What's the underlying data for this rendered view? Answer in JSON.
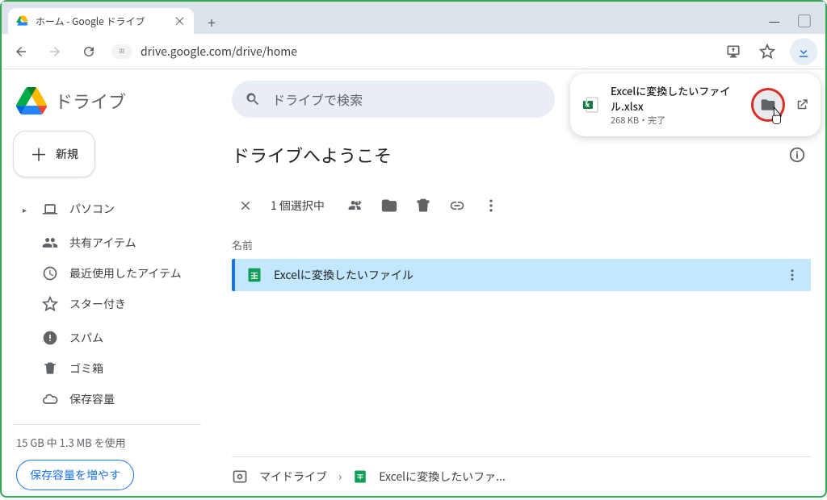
{
  "tab": {
    "title": "ホーム - Google ドライブ"
  },
  "omnibox": {
    "url": "drive.google.com/drive/home"
  },
  "download": {
    "filename": "Excelに変換したいファイル.xlsx",
    "status": "268 KB・完了"
  },
  "brand": {
    "name": "ドライブ"
  },
  "newButton": {
    "label": "新規"
  },
  "sidebar": {
    "computers": "パソコン",
    "shared": "共有アイテム",
    "recent": "最近使用したアイテム",
    "starred": "スター付き",
    "spam": "スパム",
    "trash": "ゴミ箱",
    "storage": "保存容量"
  },
  "storage": {
    "usage": "15 GB 中 1.3 MB を使用",
    "buy": "保存容量を増やす"
  },
  "search": {
    "placeholder": "ドライブで検索"
  },
  "main": {
    "welcome": "ドライブへようこそ",
    "selected": "1 個選択中",
    "columnName": "名前"
  },
  "file": {
    "name": "Excelに変換したいファイル"
  },
  "breadcrumb": {
    "root": "マイドライブ",
    "current": "Excelに変換したいファ..."
  }
}
